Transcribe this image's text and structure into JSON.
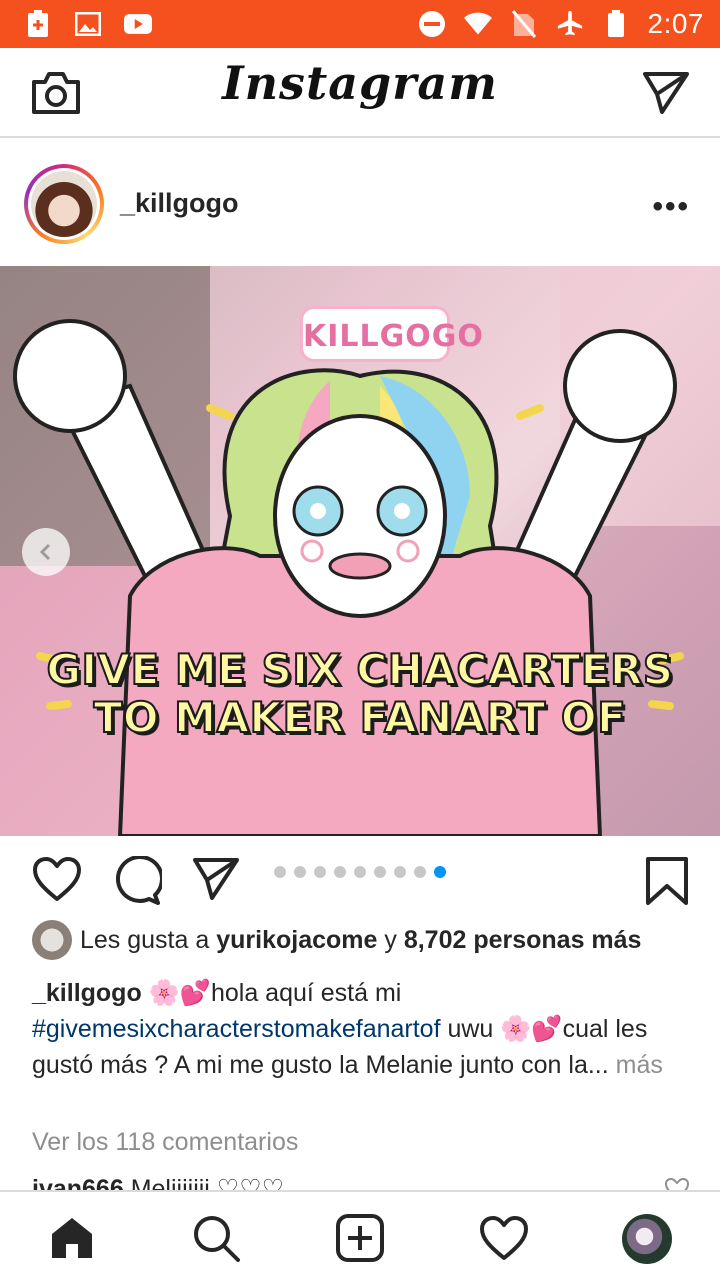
{
  "status_bar": {
    "time": "2:07",
    "icons": [
      "battery-saver-icon",
      "image-icon",
      "youtube-icon",
      "do-not-disturb-icon",
      "wifi-icon",
      "no-sim-icon",
      "airplane-icon",
      "battery-icon"
    ]
  },
  "app_bar": {
    "title": "Instagram",
    "left_icon": "camera-icon",
    "right_icon": "direct-message-icon"
  },
  "post": {
    "username": "_killgogo",
    "menu_icon": "more-options-icon",
    "image": {
      "watermark": "KILLGOGO",
      "headline_line1": "GIVE ME SIX CHACARTERS",
      "headline_line2": "TO MAKER FANART  OF"
    },
    "carousel": {
      "total": 9,
      "active_index": 8
    },
    "likes": {
      "prefix": "Les gusta a ",
      "liker": "yurikojacome",
      "middle": " y ",
      "others": "8,702 personas más"
    },
    "caption": {
      "username": "_killgogo",
      "emoji_1": "🌸💕",
      "text_1": "hola aquí está mi",
      "hashtag": "#givemesixcharacterstomakefanartof",
      "text_2": " uwu ",
      "emoji_2": "🌸💕",
      "text_3": "cual les gustó más ? A mi me gusto la Melanie junto con la...",
      "more": " más"
    },
    "comments_link": "Ver los 118 comentarios",
    "comment_preview": {
      "user": "ivan666",
      "text": " Meliiiiiii ♡♡♡"
    }
  },
  "bottom_nav": [
    "home-icon",
    "search-icon",
    "new-post-icon",
    "activity-icon",
    "profile-avatar"
  ],
  "colors": {
    "status_bar": "#f4511e",
    "link_blue": "#00376b",
    "carousel_active": "#0095f6",
    "muted": "#8e8e8e"
  }
}
